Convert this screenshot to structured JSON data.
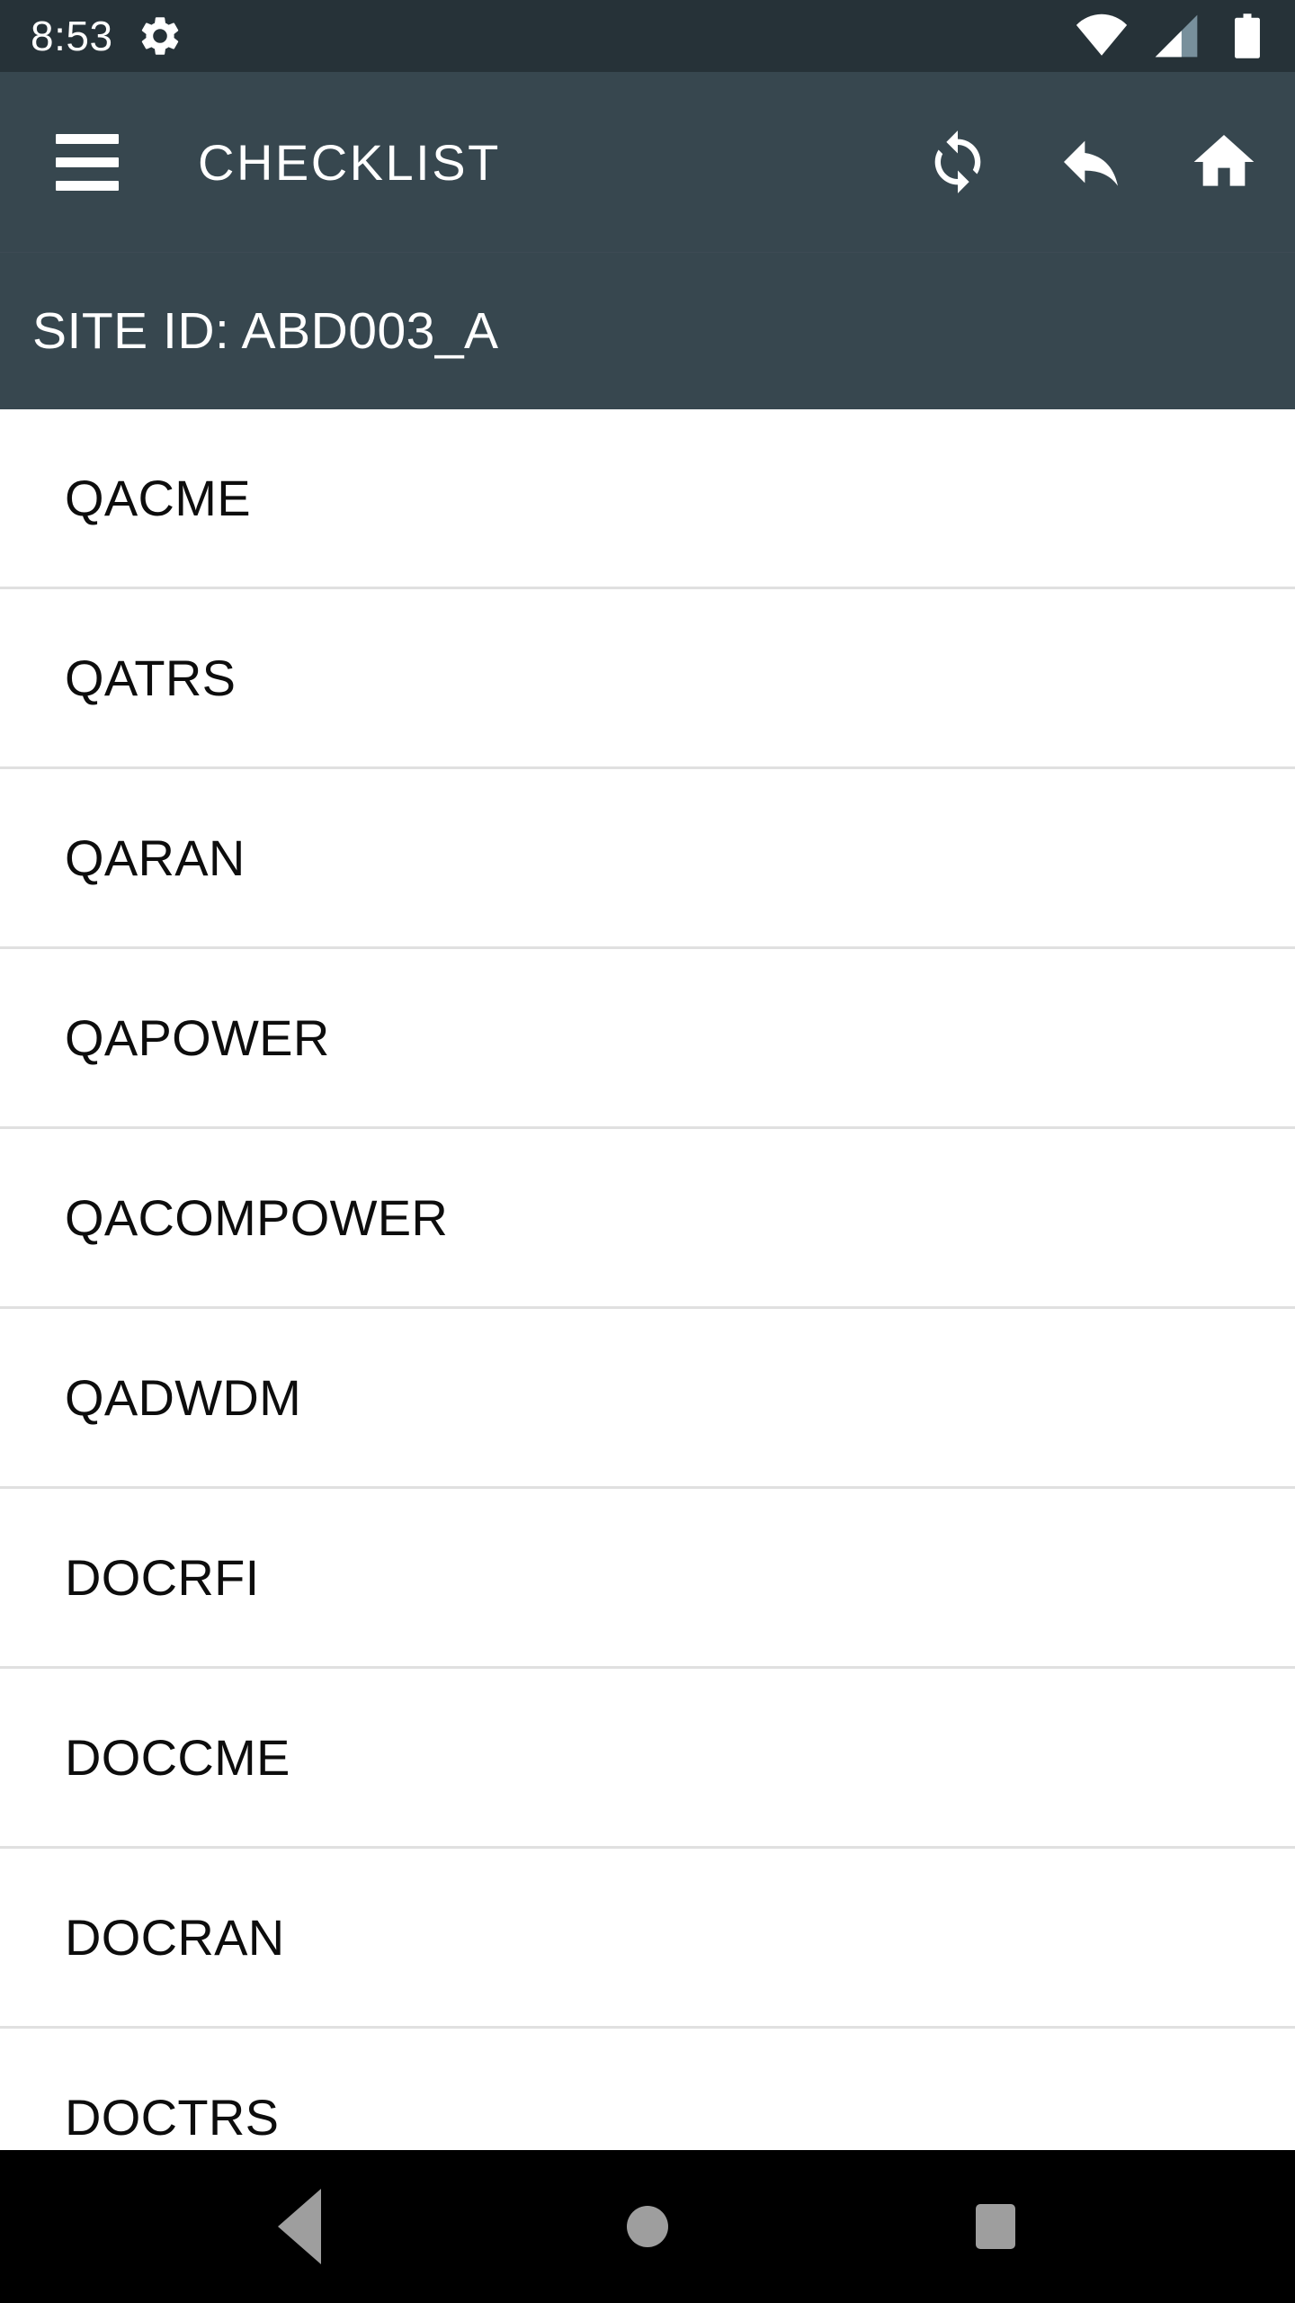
{
  "status_bar": {
    "time": "8:53",
    "icons": {
      "settings": "gear-icon",
      "wifi": "wifi-icon",
      "cellular": "cellular-signal-icon",
      "battery": "battery-full-icon"
    },
    "background_color": "#263238"
  },
  "toolbar": {
    "menu_icon": "hamburger-menu-icon",
    "title": "CHECKLIST",
    "actions": [
      {
        "name": "sync-icon",
        "label": "Sync"
      },
      {
        "name": "reply-back-icon",
        "label": "Back"
      },
      {
        "name": "home-icon",
        "label": "Home"
      }
    ],
    "background_color": "#37474F"
  },
  "site_bar": {
    "text": "SITE ID: ABD003_A",
    "background_color": "#37474F"
  },
  "checklist": {
    "items": [
      {
        "label": "QACME"
      },
      {
        "label": "QATRS"
      },
      {
        "label": "QARAN"
      },
      {
        "label": "QAPOWER"
      },
      {
        "label": "QACOMPOWER"
      },
      {
        "label": "QADWDM"
      },
      {
        "label": "DOCRFI"
      },
      {
        "label": "DOCCME"
      },
      {
        "label": "DOCRAN"
      },
      {
        "label": "DOCTRS"
      }
    ],
    "divider_color": "#E0E0E0",
    "text_color": "#0d0d0d"
  },
  "nav_bar": {
    "buttons": [
      {
        "name": "nav-back-button",
        "label": "Back"
      },
      {
        "name": "nav-home-button",
        "label": "Home"
      },
      {
        "name": "nav-recents-button",
        "label": "Recents"
      }
    ],
    "background_color": "#000000",
    "icon_color": "#9e9e9e"
  }
}
